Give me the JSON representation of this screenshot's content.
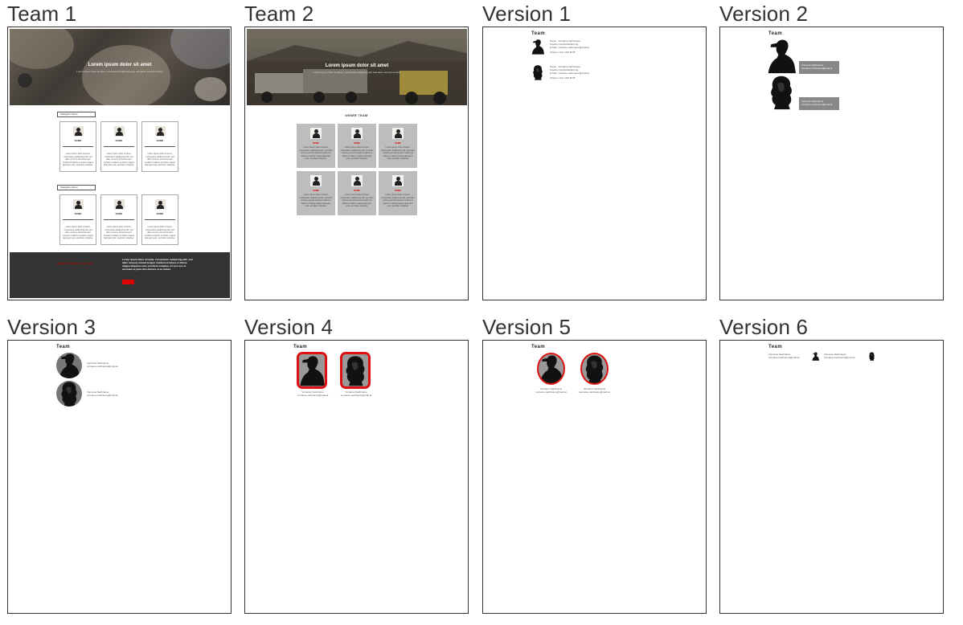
{
  "tiles": [
    {
      "label": "Team 1"
    },
    {
      "label": "Team 2"
    },
    {
      "label": "Version 1"
    },
    {
      "label": "Version 2"
    },
    {
      "label": "Version 3"
    },
    {
      "label": "Version 4"
    },
    {
      "label": "Version 5"
    },
    {
      "label": "Version 6"
    }
  ],
  "team1": {
    "hero_title": "Lorem ipsum dolor sit amet",
    "hero_sub": "Lorem ipsum dolor sit amet, consectetur adipiscing elit, sed diam nonumy eirmod",
    "section1": "Kategorie Name",
    "section2": "Kategorie Name",
    "card_name": "NAME",
    "card_text": "Lorem ipsum dolor sit amet, consectetur sadipscing elitr, sed diam nonumy eirmod tempor invidunt ut labore et dolore magna aliquyam erat, sed diam voluptua.",
    "footer_red": "LOREM IPSUM DOLOR SIT AMET",
    "footer_text": "Lorem ipsum dolor sit amet, consectetur sadipscing elitr, sed diam nonumy eirmod tempor invidunt ut labore et dolore magna aliquyam erat, sed diam voluptua. At vero eos et accusam et justo duo dolores et ea rebum."
  },
  "team2": {
    "hero_title": "Lorem ipsum dolor sit amet",
    "hero_sub": "Lorem ipsum dolor sit amet, consectetur adipiscing elit, sed diam nonumy eirmod",
    "heading": "UNSER TEAM",
    "card_name": "NAME",
    "card_text": "Lorem ipsum dolor sit amet, consectetur sadipscing elitr, sed diam nonumy eirmod tempor invidunt ut labore et dolore magna aliquyam erat, sed diam voluptua."
  },
  "versions": {
    "team_title": "Team",
    "v1_rows": [
      {
        "k": "Name",
        "v": "Vorname Nachname"
      },
      {
        "k": "Position",
        "v": "Geschäftsführung"
      },
      {
        "k": "E-Mail",
        "v": "vorname.nachname@mail.at"
      },
      {
        "k": "Telefon",
        "v": "+43 1 234 5678"
      }
    ],
    "person_name": "Vorname Nachname",
    "person_email": "vorname.nachname@mail.at"
  },
  "colors": {
    "accent_red": "#d11111",
    "footer_dark": "#333333",
    "card_grey": "#bdbdbd",
    "name_box_grey": "#888888"
  }
}
